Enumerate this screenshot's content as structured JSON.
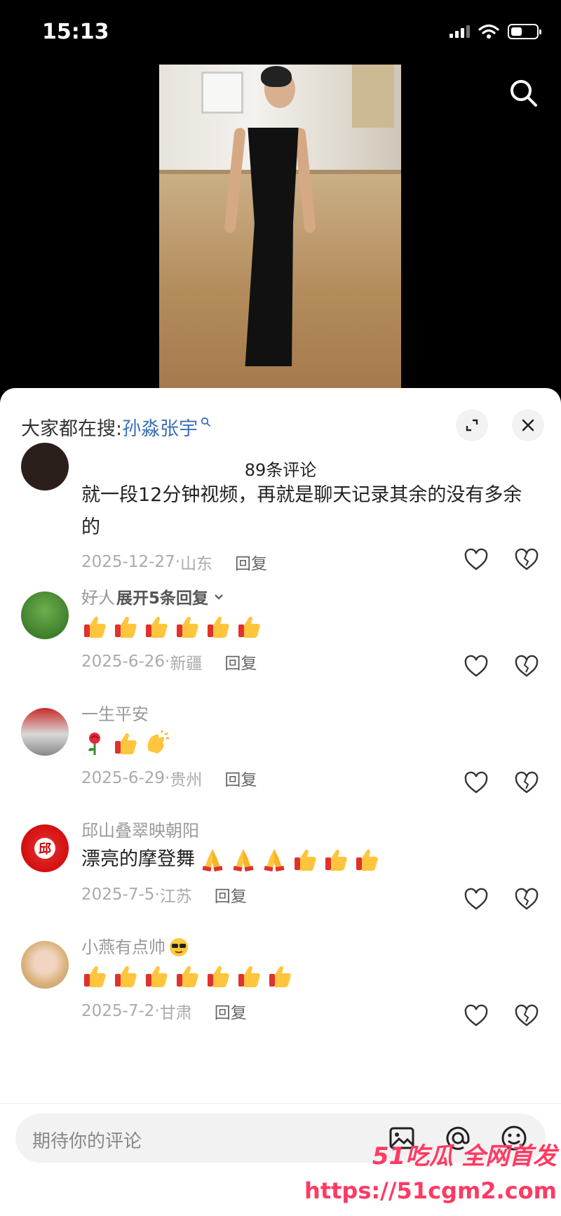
{
  "status": {
    "time": "15:13",
    "battery_level": 0.45
  },
  "sheet": {
    "hot_search_prefix": "大家都在搜:",
    "hot_search_term": "孙淼张宇",
    "comment_count": "89条评论"
  },
  "comments": [
    {
      "name": "",
      "text": "就一段12分钟视频，再就是聊天记录其余的没有多余的",
      "date": "2025-12-27",
      "location": "山东",
      "reply_label": "回复",
      "expand_label": "展开5条回复"
    },
    {
      "name": "好人",
      "emojis": [
        "thumbs-up",
        "thumbs-up",
        "thumbs-up",
        "thumbs-up",
        "thumbs-up",
        "thumbs-up"
      ],
      "date": "2025-6-26",
      "location": "新疆",
      "reply_label": "回复"
    },
    {
      "name": "一生平安",
      "emojis": [
        "rose",
        "thumbs-up",
        "clap"
      ],
      "date": "2025-6-29",
      "location": "贵州",
      "reply_label": "回复"
    },
    {
      "name": "邱山叠翠映朝阳",
      "text": "漂亮的摩登舞",
      "emojis": [
        "pray",
        "pray",
        "pray",
        "thumbs-up",
        "thumbs-up",
        "thumbs-up"
      ],
      "date": "2025-7-5",
      "location": "江苏",
      "reply_label": "回复",
      "avatar_text": "邱"
    },
    {
      "name": "小燕有点帅",
      "name_emoji": "sunglasses",
      "emojis": [
        "thumbs-up",
        "thumbs-up",
        "thumbs-up",
        "thumbs-up",
        "thumbs-up",
        "thumbs-up",
        "thumbs-up"
      ],
      "date": "2025-7-2",
      "location": "甘肃",
      "reply_label": "回复"
    }
  ],
  "composer": {
    "placeholder": "期待你的评论"
  },
  "watermark": {
    "line1": "51吃瓜 全网首发",
    "line2": "https://51cgm2.com"
  },
  "colors": {
    "accent": "#3a6fb8",
    "watermark": "#ff3a63"
  }
}
